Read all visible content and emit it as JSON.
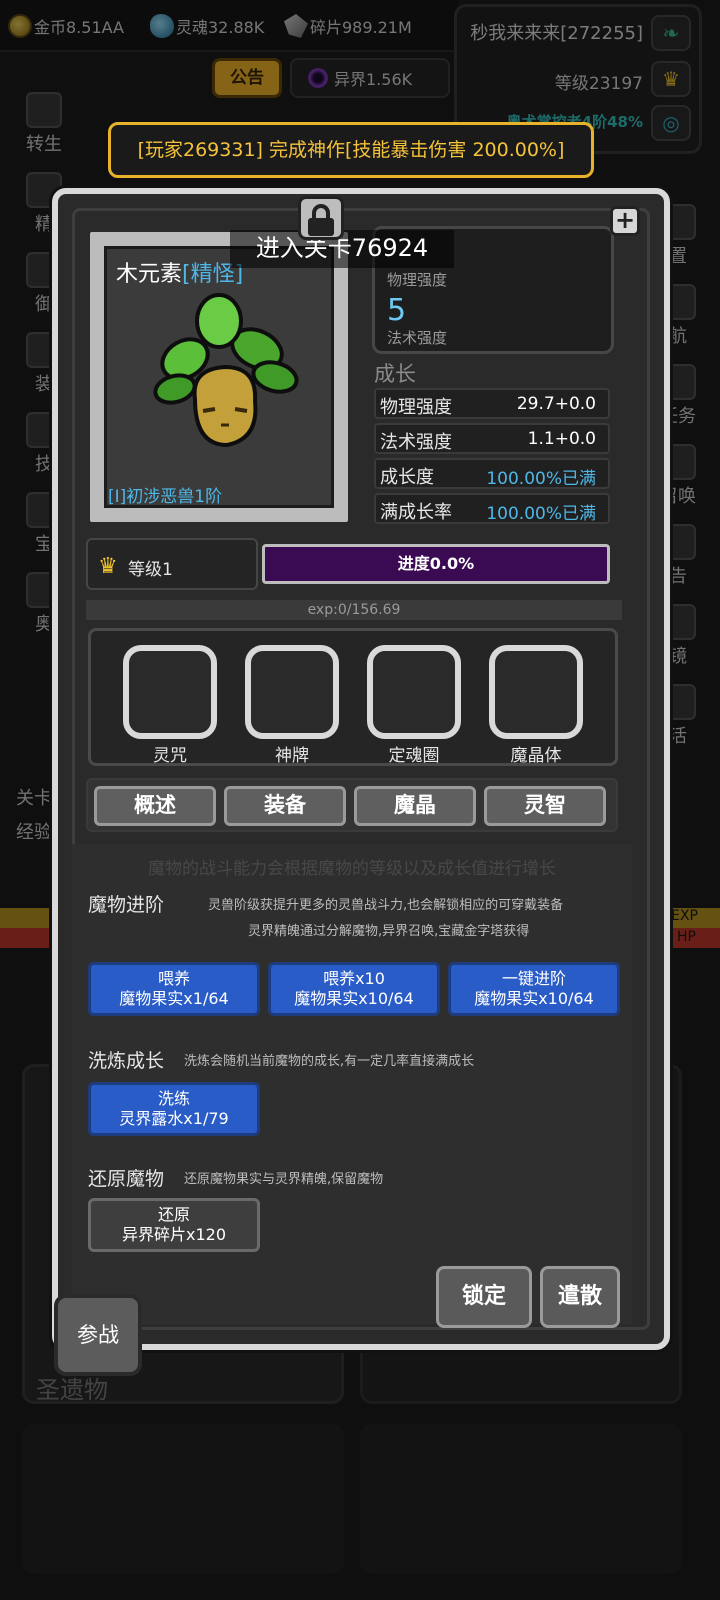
{
  "resources": {
    "gold": "金币8.51AA",
    "soul": "灵魂32.88K",
    "shard": "碎片989.21M",
    "other_world": "异界1.56K"
  },
  "player": {
    "name": "秒我来来来[272255]",
    "level": "等级23197",
    "title": "奥术掌控者4阶48%"
  },
  "notice_tab": "公告",
  "broadcast": "[玩家269331] 完成神作[技能暴击伤害 200.00%]",
  "background": {
    "left_menu": [
      "转生",
      "精",
      "御",
      "装",
      "技",
      "宝",
      "奥"
    ],
    "right_menu": [
      "置",
      "航",
      "任务",
      "召唤",
      "告",
      "镜",
      "活"
    ],
    "relic_label": "圣遗物",
    "exp_tag": "EXP",
    "hp_tag": "HP",
    "stage_prefix": "关卡",
    "exp_prefix": "经验"
  },
  "monster": {
    "name": "木元素",
    "tag": "[精怪]",
    "tier": "[I]初涉恶兽1阶",
    "enter_stage": "进入关卡76924",
    "stat_phys_label": "物理强度",
    "stat_magic_value": "5",
    "stat_magic_label": "法术强度"
  },
  "growth": {
    "title": "成长",
    "rows": [
      {
        "label": "物理强度",
        "value": "29.7+0.0",
        "highlight": false
      },
      {
        "label": "法术强度",
        "value": "1.1+0.0",
        "highlight": false
      },
      {
        "label": "成长度",
        "value": "100.00%已满",
        "highlight": true
      },
      {
        "label": "满成长率",
        "value": "100.00%已满",
        "highlight": true
      }
    ]
  },
  "level": {
    "label": "等级1",
    "progress_text": "进度0.0%",
    "progress_fraction": 0.0,
    "exp_text": "exp:0/156.69"
  },
  "slots": [
    "灵咒",
    "神牌",
    "定魂圈",
    "魔晶体"
  ],
  "tabs": [
    "概述",
    "装备",
    "魔晶",
    "灵智"
  ],
  "overview": {
    "header": "魔物的战斗能力会根据魔物的等级以及成长值进行增长",
    "advance": {
      "title": "魔物进阶",
      "desc1": "灵兽阶级获提升更多的灵兽战斗力,也会解锁相应的可穿戴装备",
      "desc2": "灵界精魄通过分解魔物,异界召唤,宝藏金字塔获得",
      "buttons": [
        {
          "line1": "喂养",
          "line2": "魔物果实x1/64"
        },
        {
          "line1": "喂养x10",
          "line2": "魔物果实x10/64"
        },
        {
          "line1": "一键进阶",
          "line2": "魔物果实x10/64"
        }
      ]
    },
    "refine": {
      "title": "洗炼成长",
      "desc": "洗炼会随机当前魔物的成长,有一定几率直接满成长",
      "button": {
        "line1": "洗练",
        "line2": "灵界露水x1/79"
      }
    },
    "restore": {
      "title": "还原魔物",
      "desc": "还原魔物果实与灵界精魄,保留魔物",
      "button": {
        "line1": "还原",
        "line2": "异界碎片x120"
      }
    }
  },
  "actions": {
    "lock": "锁定",
    "dismiss": "遣散",
    "join_battle": "参战"
  },
  "colors": {
    "accent_gold": "#f5c33a",
    "info_blue": "#4fb7e8",
    "button_blue": "#2a5cc8",
    "progress_purple": "#3a0a52"
  }
}
